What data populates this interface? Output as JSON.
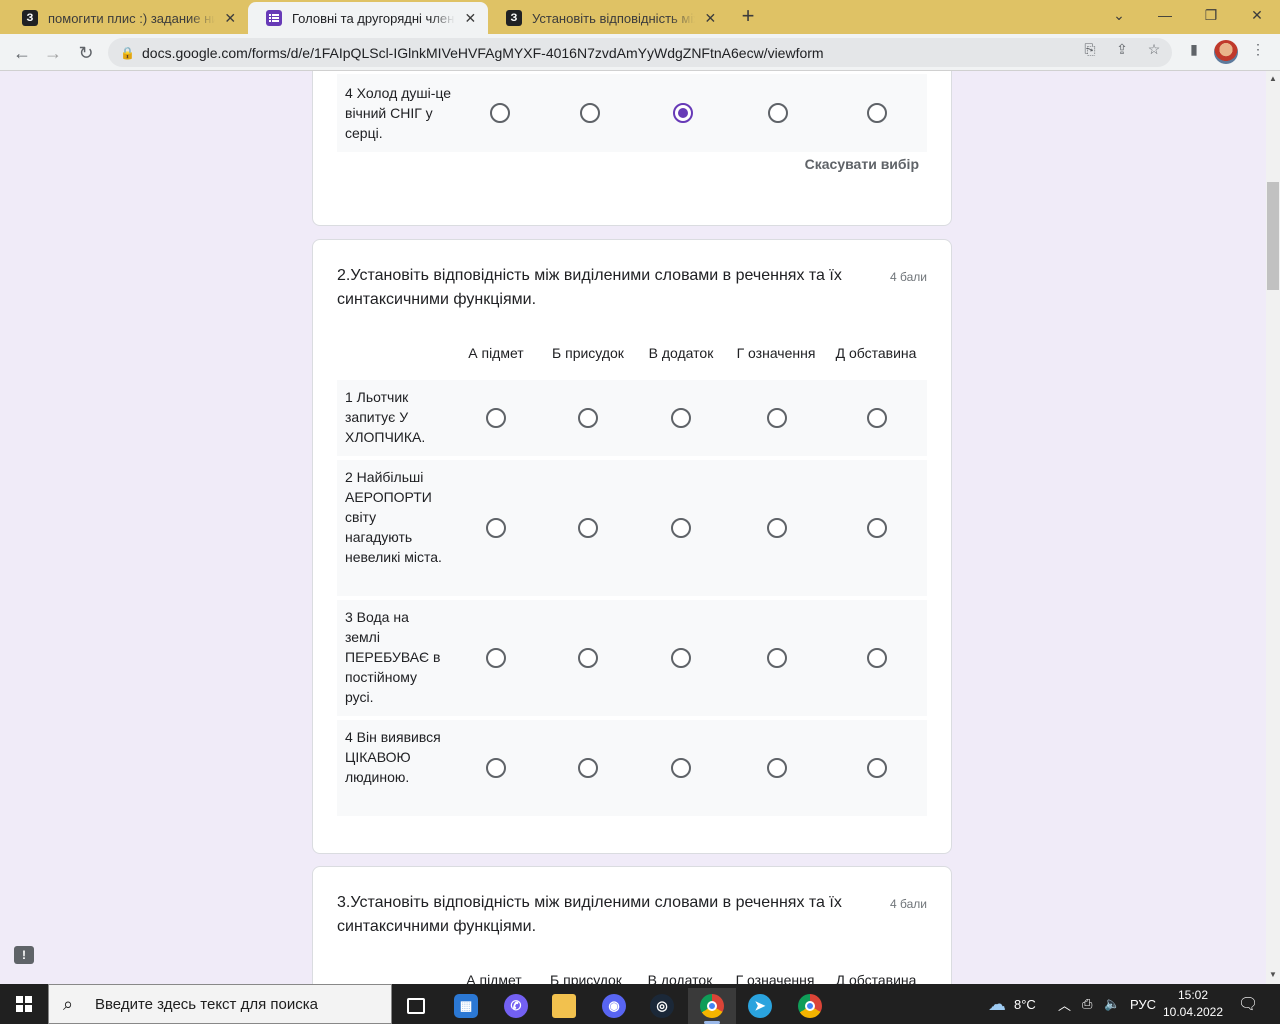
{
  "browser": {
    "tabs": [
      {
        "favicon": "znanija-icon",
        "title": "помогити плис :) задание ниже",
        "close": "✕"
      },
      {
        "favicon": "google-forms-icon",
        "title": "Головні та другорядні члени ре",
        "close": "✕"
      },
      {
        "favicon": "znanija-icon",
        "title": "Установіть відповідність між ви",
        "close": "✕"
      }
    ],
    "url": "docs.google.com/forms/d/e/1FAIpQLScl-IGlnkMIVeHVFAgMYXF-4016N7zvdAmYyWdgZNFtnA6ecw/viewform"
  },
  "form": {
    "q1_partial": {
      "row_label": "4 Холод душі-це вічний СНІГ у серці.",
      "selected_column_index": 2,
      "clear_label": "Скасувати вибір"
    },
    "q2": {
      "title": "2.Установіть відповідність між виділеними словами в реченнях та їх синтаксичними функціями.",
      "points": "4 бали",
      "columns": [
        "А підмет",
        "Б присудок",
        "В додаток",
        "Г означення",
        "Д обставина"
      ],
      "rows": [
        "1 Льотчик запитує У ХЛОПЧИКА.",
        "2 Найбільші АЕРОПОРТИ світу нагадують невеликі міста.",
        "3 Вода на землі ПЕРЕБУВАЄ в постійному русі.",
        "4 Він виявився ЦІКАВОЮ людиною."
      ]
    },
    "q3": {
      "title": "3.Установіть відповідність між виділеними словами в реченнях та їх синтаксичними функціями.",
      "points": "4 бали",
      "columns": [
        "А підмет",
        "Б присудок",
        "В додаток",
        "Г означення",
        "Д обставина"
      ]
    }
  },
  "taskbar": {
    "search_placeholder": "Введите здесь текст для поиска",
    "weather": "8°C",
    "language": "РУС",
    "time": "15:02",
    "date": "10.04.2022"
  },
  "colors": {
    "accent": "#673ab7",
    "background": "#f0ebf8",
    "titlebar": "#dfc265"
  }
}
